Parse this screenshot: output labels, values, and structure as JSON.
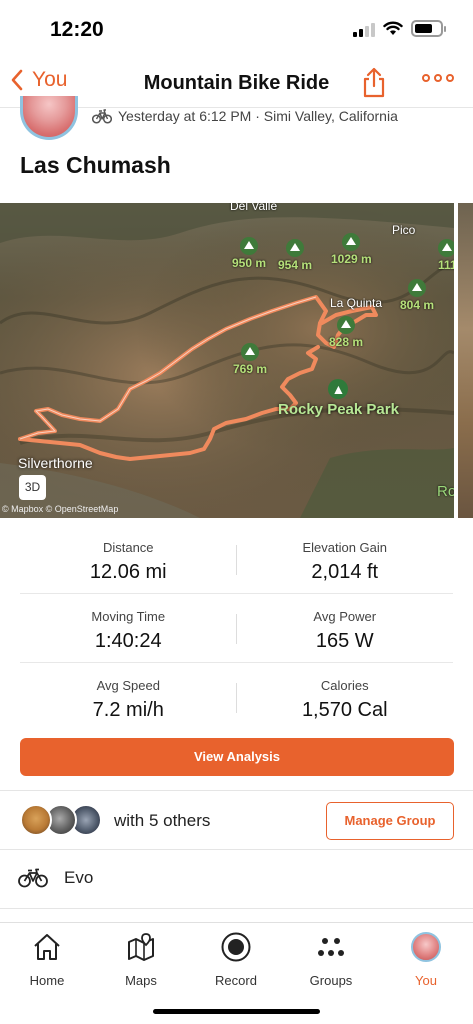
{
  "status_bar": {
    "time": "12:20"
  },
  "nav": {
    "back_label": "You",
    "title": "Mountain Bike Ride"
  },
  "activity": {
    "meta": "Yesterday at 6:12 PM · Simi Valley, California",
    "title": "Las Chumash"
  },
  "map": {
    "places": {
      "del_valle": "Del Valle",
      "pico": "Pico",
      "la_quinta": "La Quinta"
    },
    "peaks": [
      "950 m",
      "954 m",
      "1029 m",
      "111",
      "804 m",
      "828 m",
      "769 m"
    ],
    "park_label": "Rocky Peak Park",
    "town_label": "Silverthorne",
    "partial_label": "Ro",
    "btn_3d": "3D",
    "attribution": "© Mapbox © OpenStreetMap",
    "route_color": "#f08a5d"
  },
  "stats": [
    [
      {
        "label": "Distance",
        "value": "12.06 mi"
      },
      {
        "label": "Elevation Gain",
        "value": "2,014 ft"
      }
    ],
    [
      {
        "label": "Moving Time",
        "value": "1:40:24"
      },
      {
        "label": "Avg Power",
        "value": "165 W"
      }
    ],
    [
      {
        "label": "Avg Speed",
        "value": "7.2 mi/h"
      },
      {
        "label": "Calories",
        "value": "1,570 Cal"
      }
    ]
  ],
  "analysis_button": "View Analysis",
  "group": {
    "others_text": "with 5 others",
    "manage_button": "Manage Group"
  },
  "gear": {
    "bike_name": "Evo"
  },
  "tabs": [
    {
      "label": "Home",
      "icon": "home-icon"
    },
    {
      "label": "Maps",
      "icon": "maps-icon"
    },
    {
      "label": "Record",
      "icon": "record-icon"
    },
    {
      "label": "Groups",
      "icon": "groups-icon"
    },
    {
      "label": "You",
      "icon": "you-avatar",
      "active": true
    }
  ],
  "colors": {
    "accent": "#e8622d",
    "text": "#111111",
    "muted": "#444444"
  }
}
